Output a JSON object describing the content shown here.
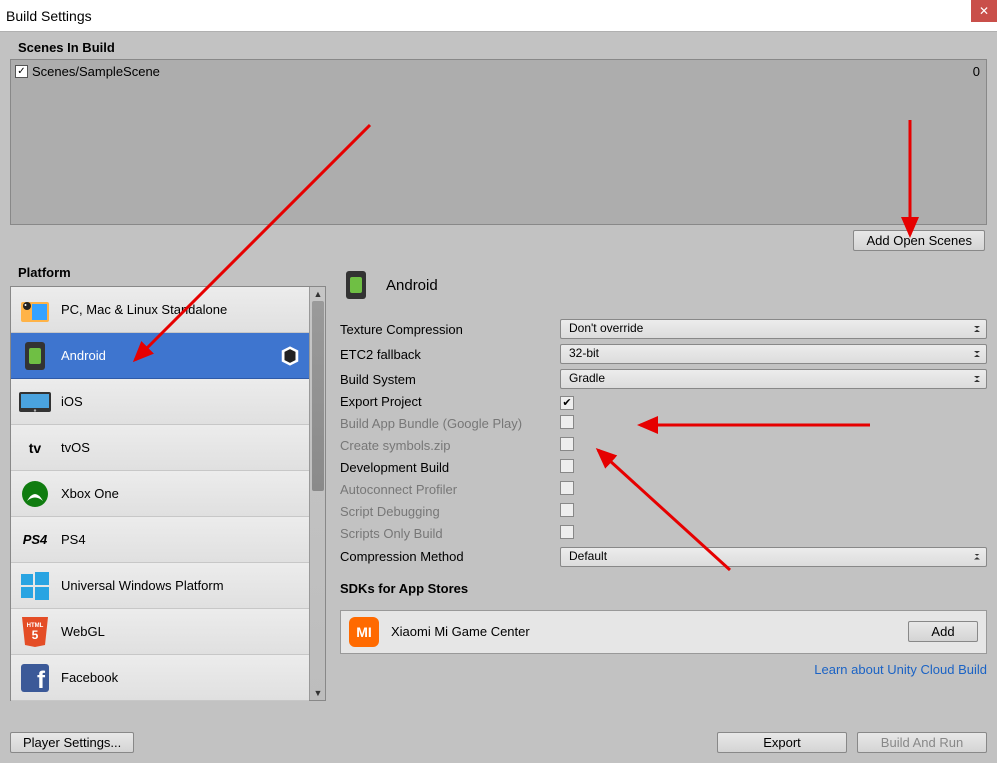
{
  "window": {
    "title": "Build Settings"
  },
  "scenes": {
    "section_label": "Scenes In Build",
    "items": [
      {
        "name": "Scenes/SampleScene",
        "checked": true,
        "index": "0"
      }
    ],
    "add_open_label": "Add Open Scenes"
  },
  "platform": {
    "section_label": "Platform",
    "items": [
      {
        "id": "standalone",
        "label": "PC, Mac & Linux Standalone"
      },
      {
        "id": "android",
        "label": "Android",
        "selected": true,
        "unity_mark": true
      },
      {
        "id": "ios",
        "label": "iOS"
      },
      {
        "id": "tvos",
        "label": "tvOS"
      },
      {
        "id": "xboxone",
        "label": "Xbox One"
      },
      {
        "id": "ps4",
        "label": "PS4"
      },
      {
        "id": "uwp",
        "label": "Universal Windows Platform"
      },
      {
        "id": "webgl",
        "label": "WebGL"
      },
      {
        "id": "facebook",
        "label": "Facebook"
      }
    ]
  },
  "details": {
    "title": "Android",
    "rows": {
      "texture_compression": {
        "label": "Texture Compression",
        "value": "Don't override"
      },
      "etc2_fallback": {
        "label": "ETC2 fallback",
        "value": "32-bit"
      },
      "build_system": {
        "label": "Build System",
        "value": "Gradle"
      },
      "export_project": {
        "label": "Export Project",
        "checked": true
      },
      "build_app_bundle": {
        "label": "Build App Bundle (Google Play)",
        "checked": false,
        "disabled": true
      },
      "create_symbols": {
        "label": "Create symbols.zip",
        "checked": false,
        "disabled": true
      },
      "development_build": {
        "label": "Development Build",
        "checked": false
      },
      "autoconnect_profiler": {
        "label": "Autoconnect Profiler",
        "checked": false,
        "disabled": true
      },
      "script_debugging": {
        "label": "Script Debugging",
        "checked": false,
        "disabled": true
      },
      "scripts_only_build": {
        "label": "Scripts Only Build",
        "checked": false,
        "disabled": true
      },
      "compression_method": {
        "label": "Compression Method",
        "value": "Default"
      }
    },
    "sdks_label": "SDKs for App Stores",
    "sdks": [
      {
        "name": "Xiaomi Mi Game Center",
        "action": "Add"
      }
    ],
    "cloud_link": "Learn about Unity Cloud Build"
  },
  "footer": {
    "player_settings": "Player Settings...",
    "export": "Export",
    "build_and_run": "Build And Run"
  }
}
